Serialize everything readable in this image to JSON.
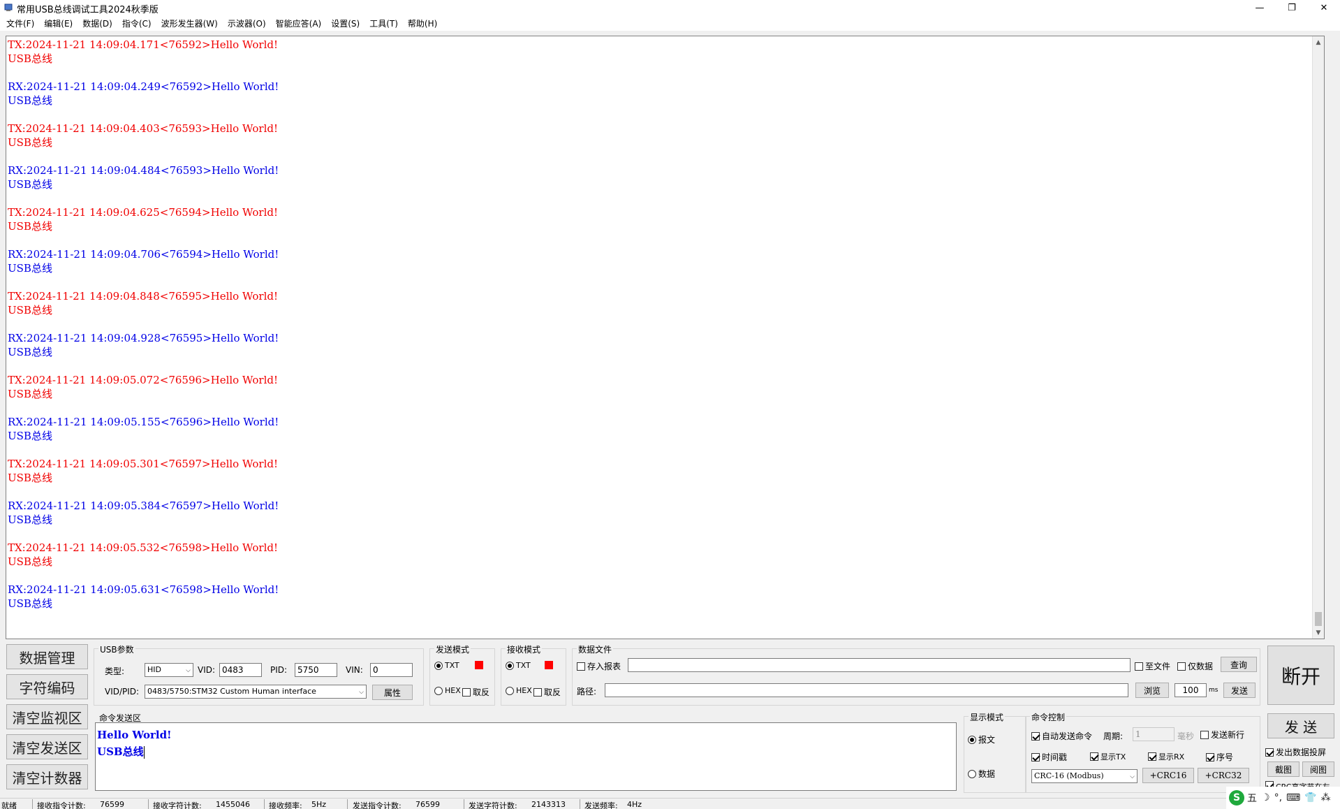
{
  "window": {
    "title": "常用USB总线调试工具2024秋季版",
    "minimize": "—",
    "maximize": "❐",
    "close": "✕"
  },
  "menu": [
    "文件(F)",
    "编辑(E)",
    "数据(D)",
    "指令(C)",
    "波形发生器(W)",
    "示波器(O)",
    "智能应答(A)",
    "设置(S)",
    "工具(T)",
    "帮助(H)"
  ],
  "log": [
    {
      "dir": "tx",
      "head": "TX:2024-11-21 14:09:04.171<76592>Hello World!",
      "body": "USB总线"
    },
    {
      "dir": "rx",
      "head": "RX:2024-11-21 14:09:04.249<76592>Hello World!",
      "body": "USB总线"
    },
    {
      "dir": "tx",
      "head": "TX:2024-11-21 14:09:04.403<76593>Hello World!",
      "body": "USB总线"
    },
    {
      "dir": "rx",
      "head": "RX:2024-11-21 14:09:04.484<76593>Hello World!",
      "body": "USB总线"
    },
    {
      "dir": "tx",
      "head": "TX:2024-11-21 14:09:04.625<76594>Hello World!",
      "body": "USB总线"
    },
    {
      "dir": "rx",
      "head": "RX:2024-11-21 14:09:04.706<76594>Hello World!",
      "body": "USB总线"
    },
    {
      "dir": "tx",
      "head": "TX:2024-11-21 14:09:04.848<76595>Hello World!",
      "body": "USB总线"
    },
    {
      "dir": "rx",
      "head": "RX:2024-11-21 14:09:04.928<76595>Hello World!",
      "body": "USB总线"
    },
    {
      "dir": "tx",
      "head": "TX:2024-11-21 14:09:05.072<76596>Hello World!",
      "body": "USB总线"
    },
    {
      "dir": "rx",
      "head": "RX:2024-11-21 14:09:05.155<76596>Hello World!",
      "body": "USB总线"
    },
    {
      "dir": "tx",
      "head": "TX:2024-11-21 14:09:05.301<76597>Hello World!",
      "body": "USB总线"
    },
    {
      "dir": "rx",
      "head": "RX:2024-11-21 14:09:05.384<76597>Hello World!",
      "body": "USB总线"
    },
    {
      "dir": "tx",
      "head": "TX:2024-11-21 14:09:05.532<76598>Hello World!",
      "body": "USB总线"
    },
    {
      "dir": "rx",
      "head": "RX:2024-11-21 14:09:05.631<76598>Hello World!",
      "body": "USB总线"
    }
  ],
  "left_buttons": {
    "data_manage": "数据管理",
    "char_encode": "字符编码",
    "clear_monitor": "清空监视区",
    "clear_send": "清空发送区",
    "clear_counter": "清空计数器"
  },
  "usb_params": {
    "title": "USB参数",
    "type_label": "类型:",
    "type_value": "HID",
    "vid_label": "VID:",
    "vid_value": "0483",
    "pid_label": "PID:",
    "pid_value": "5750",
    "vin_label": "VIN:",
    "vin_value": "0",
    "vidpid_label": "VID/PID:",
    "vidpid_value": "0483/5750:STM32 Custom Human interface",
    "props_button": "属性"
  },
  "send_mode": {
    "title": "发送模式",
    "txt": "TXT",
    "hex": "HEX",
    "invert": "取反",
    "selected": "TXT"
  },
  "recv_mode": {
    "title": "接收模式",
    "txt": "TXT",
    "hex": "HEX",
    "invert": "取反",
    "selected": "TXT"
  },
  "data_file": {
    "title": "数据文件",
    "save_report": "存入报表",
    "to_file": "至文件",
    "data_only": "仅数据",
    "query_button": "查询",
    "path_label": "路径:",
    "path_value": "",
    "report_value": "",
    "browse_button": "浏览",
    "interval_value": "100",
    "interval_unit": "ms",
    "send_button": "发送"
  },
  "disconnect_button": "断开",
  "command_area": {
    "title": "命令发送区",
    "line1": "Hello World!",
    "line2": "USB总线"
  },
  "display_mode": {
    "title": "显示模式",
    "message": "报文",
    "data": "数据",
    "selected": "报文"
  },
  "command_control": {
    "title": "命令控制",
    "auto_send": "自动发送命令",
    "period_label": "周期:",
    "period_value": "1",
    "period_unit": "毫秒",
    "send_newline": "发送新行",
    "timestamp": "时间戳",
    "show_tx": "显示TX",
    "show_rx": "显示RX",
    "seq_no": "序号",
    "crc_select": "CRC-16 (Modbus)",
    "crc16_button": "+CRC16",
    "crc32_button": "+CRC32"
  },
  "send_button": "发 送",
  "right_small": {
    "send_data_screen": "发出数据投屏",
    "screenshot_button": "截图",
    "read_button": "阅图",
    "crc_partial": "CRC高字节在左"
  },
  "status": {
    "ready": "就绪",
    "recv_cmd_label": "接收指令计数:",
    "recv_cmd_value": "76599",
    "recv_char_label": "接收字符计数:",
    "recv_char_value": "1455046",
    "recv_freq_label": "接收频率:",
    "recv_freq_value": "5Hz",
    "send_cmd_label": "发送指令计数:",
    "send_cmd_value": "76599",
    "send_char_label": "发送字符计数:",
    "send_char_value": "2143313",
    "send_freq_label": "发送频率:",
    "send_freq_value": "4Hz"
  },
  "ime": {
    "logo": "S",
    "mode": "五",
    "moon": "☽",
    "punct": "°,",
    "keyboard": "⌨",
    "user": "👕",
    "grid": "⁂"
  },
  "colors": {
    "tx": "#f00000",
    "rx": "#0000e6",
    "indicator": "#ff0000"
  }
}
